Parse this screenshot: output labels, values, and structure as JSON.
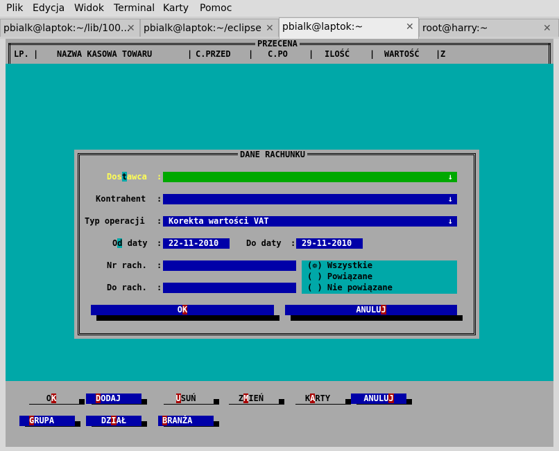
{
  "menubar": {
    "items": [
      "Plik",
      "Edycja",
      "Widok",
      "Terminal",
      "Karty",
      "Pomoc"
    ]
  },
  "tabs": [
    {
      "label": "pbialk@laptok:~/lib/100..."
    },
    {
      "label": "pbialk@laptok:~/eclipse"
    },
    {
      "label": "pbialk@laptok:~"
    },
    {
      "label": "root@harry:~"
    }
  ],
  "screen": {
    "title": "PRZECENA",
    "columns": [
      "LP.",
      "NAZWA KASOWA TOWARU",
      "C.PRZED",
      "C.PO",
      "ILOŚĆ",
      "WARTOŚĆ",
      "Z"
    ]
  },
  "dialog": {
    "title": "DANE RACHUNKU",
    "dostawca": {
      "label_pre": "Dos",
      "label_hot": "t",
      "label_post": "awca",
      "sep": ":",
      "value": ""
    },
    "kontrahent": {
      "label": "Kontrahent",
      "sep": ":",
      "value": ""
    },
    "typ": {
      "label": "Typ operacji",
      "sep": ":",
      "value": "Korekta wartości VAT"
    },
    "od": {
      "label_pre": "O",
      "label_hot": "d",
      "label_post": " daty",
      "sep": ":",
      "value": "22-11-2010"
    },
    "do": {
      "label": "Do daty",
      "sep": ":",
      "value": "29-11-2010"
    },
    "nr_rach": {
      "label": "Nr rach.",
      "sep": ":",
      "value": ""
    },
    "do_rach": {
      "label": "Do rach.",
      "sep": ":",
      "value": ""
    },
    "radio": [
      {
        "mark": "(❁)",
        "label": "Wszystkie"
      },
      {
        "mark": "( )",
        "label": "Powiązane"
      },
      {
        "mark": "( )",
        "label": "Nie powiązane"
      }
    ],
    "ok": {
      "pre": "O",
      "hot": "K",
      "post": ""
    },
    "cancel": {
      "pre": "ANULU",
      "hot": "J",
      "post": ""
    },
    "arrow": "↓"
  },
  "bottom_buttons": [
    {
      "pre": "O",
      "hot": "K",
      "post": ""
    },
    {
      "pre": "",
      "hot": "D",
      "post": "ODAJ"
    },
    {
      "pre": "",
      "hot": "U",
      "post": "SUŃ"
    },
    {
      "pre": "Z",
      "hot": "M",
      "post": "IEŃ"
    },
    {
      "pre": "K",
      "hot": "A",
      "post": "RTY"
    },
    {
      "pre": "ANULU",
      "hot": "J",
      "post": ""
    },
    {
      "pre": "",
      "hot": "G",
      "post": "RUPA"
    },
    {
      "pre": "DZ",
      "hot": "I",
      "post": "AŁ"
    },
    {
      "pre": "",
      "hot": "B",
      "post": "RANŻA"
    }
  ],
  "tab_close_icon": "✕",
  "colors": {
    "teal": "#00a8a8",
    "blue": "#0000a8",
    "green": "#00a800",
    "yellow": "#ffff54",
    "red": "#a80000"
  }
}
